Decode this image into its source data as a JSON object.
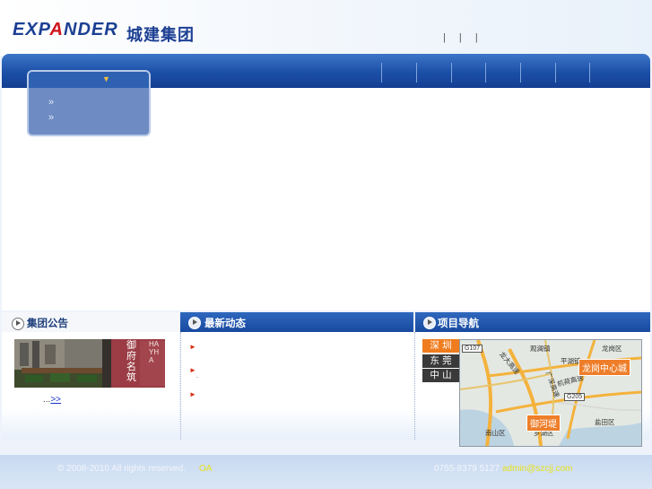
{
  "header": {
    "logo_en_part1": "EXP",
    "logo_en_a": "A",
    "logo_en_part2": "NDER",
    "logo_cn": "城建集团",
    "top_links": [
      "|",
      "|",
      "|"
    ]
  },
  "dropdown": {
    "items": [
      "»",
      "»"
    ]
  },
  "sections": {
    "announcement": "集团公告",
    "news": "最新动态",
    "projects": "项目导航"
  },
  "announcement": {
    "photo_sign_1": "御府名筑",
    "photo_sign_2": "HAYHA",
    "more_prefix": "...",
    "more_link": ">> "
  },
  "news": {
    "items": [
      "",
      "",
      ""
    ]
  },
  "projects": {
    "cities": [
      "深 圳",
      "东 莞",
      "中 山"
    ],
    "map_tags": [
      "龙岗中心城",
      "御河堤"
    ],
    "map_labels": [
      "观澜镇",
      "龙岗区",
      "平湖镇",
      "南山区",
      "盐田区",
      "罗湖区",
      "深圳湾"
    ],
    "road_tags": [
      "G107",
      "G205"
    ],
    "road_texts": [
      "广深高速",
      "机荷高速",
      "龙大高速"
    ]
  },
  "footer": {
    "copyright": "© 2008-2010 All rights reserved.",
    "oa": "OA",
    "phone": "0755-8379 5127",
    "email": "admin@szcjj.com"
  }
}
